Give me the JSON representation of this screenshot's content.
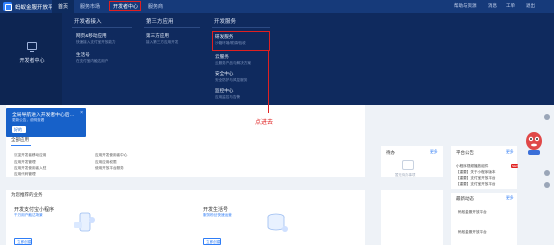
{
  "header": {
    "brand": "蚂蚁金服开放平台",
    "nav": [
      "首页",
      "服务市场",
      "开发者中心",
      "服务商"
    ],
    "top_right": [
      "帮助与资源",
      "消息",
      "工单",
      "退出"
    ]
  },
  "mega_menu": {
    "left_label": "开发者中心",
    "columns": [
      {
        "title": "开发者接入",
        "items": [
          {
            "title": "网页&移动应用",
            "desc": "快速接入支付宝开放能力"
          },
          {
            "title": "生活号",
            "desc": "在支付宝内触达用户"
          }
        ]
      },
      {
        "title": "第三方应用",
        "items": [
          {
            "title": "第三方应用",
            "desc": "接入第三方应用开发"
          }
        ]
      },
      {
        "title": "开发服务",
        "items": [
          {
            "title": "研发服务",
            "desc": "沙箱环境/联调/验收"
          },
          {
            "title": "云服务",
            "desc": "云服务产品与解决方案"
          },
          {
            "title": "安全中心",
            "desc": "安全防护与风控服务"
          },
          {
            "title": "监控中心",
            "desc": "应用监控与告警"
          }
        ]
      }
    ]
  },
  "notice": {
    "title": "全局导航进入开发者中心后…",
    "subtitle": "更新公告，说明查看",
    "button": "好的"
  },
  "annotation": "点进去",
  "main": {
    "section_title": "我的应用",
    "tab": "全部应用",
    "links": [
      "沉淀开发者移动应用",
      "应用开发管理",
      "应用开发使用者入驻",
      "应用代码管理"
    ],
    "links_right": [
      "应用开发使用者中心",
      "应用应用权限",
      "使用开放平台服务",
      "应用上线"
    ]
  },
  "todo": {
    "title": "待办",
    "more": "更多",
    "empty": "暂无待办事项"
  },
  "notices_panel": {
    "title": "平台公告",
    "more": "更多",
    "items": [
      "小程序视频播放组件",
      "【重要】关于小程序版本",
      "【重要】支付宝开放平台",
      "【重要】支付宝开放平台",
      "【重要】平台数据服务"
    ],
    "badge": "NEW"
  },
  "recommend": {
    "title": "为您推荐的业务",
    "cards": [
      {
        "title": "开发支付宝小程序",
        "sub": "千万用户触达场景",
        "button": "立即创建"
      },
      {
        "title": "开发生活号",
        "sub": "服务粉丝快速运营",
        "button": "立即创建"
      }
    ]
  },
  "latest": {
    "title": "最新动态",
    "more": "更多",
    "items": [
      "蚂蚁金服开放平台",
      "蚂蚁金服开放平台"
    ]
  },
  "colors": {
    "topbar": "#163a7a",
    "mega": "#0f2a5e",
    "accent": "#2f7df6",
    "highlight": "#e02020",
    "notice": "#1761c9"
  }
}
